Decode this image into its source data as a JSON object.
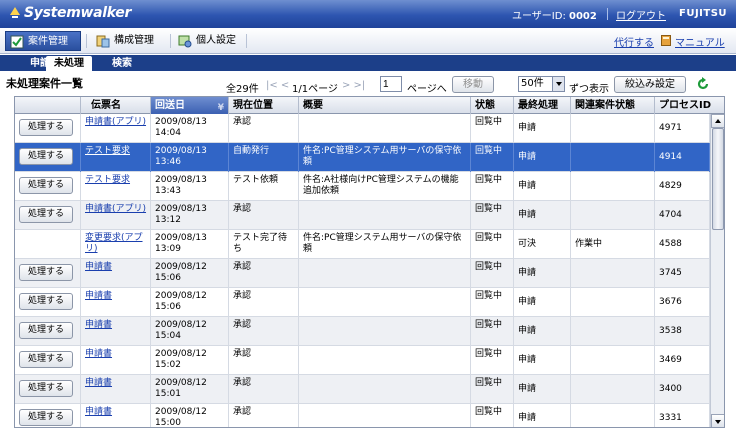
{
  "header": {
    "logo": "Systemwalker",
    "user_label": "ユーザーID:",
    "user_id": "0002",
    "logout": "ログアウト",
    "brand": "FUJITSU"
  },
  "menu": {
    "items": [
      {
        "label": "案件管理",
        "icon": "checkbox-icon",
        "active": true
      },
      {
        "label": "構成管理",
        "icon": "config-icon",
        "active": false
      },
      {
        "label": "個人設定",
        "icon": "person-settings-icon",
        "active": false
      }
    ],
    "delegate": "代行する",
    "manual": "マニュアル"
  },
  "tabs": [
    "申請",
    "未処理",
    "検索"
  ],
  "active_tab": "未処理",
  "page": {
    "title": "未処理案件一覧",
    "total": "全29件",
    "nav_arrows": "|< <",
    "page_info": "1/1ページ",
    "nav_arrows_next": "> >|",
    "page_input": "1",
    "page_to": "ページへ",
    "move_button": "移動",
    "per_page": "50件",
    "per_label": "ずつ表示",
    "filter_button": "絞込み設定"
  },
  "table": {
    "columns": [
      "",
      "伝票名",
      "回送日",
      "現在位置",
      "概要",
      "状態",
      "最終処理",
      "関連案件状態",
      "プロセスID"
    ],
    "sorted_column": "回送日",
    "rows": [
      {
        "btn": "処理する",
        "name": "申請書(アプリ)",
        "date": "2009/08/13 14:04",
        "pos": "承認",
        "summary": "",
        "status": "回覧中",
        "last": "申請",
        "related": "",
        "pid": "4971",
        "style": ""
      },
      {
        "btn": "処理する",
        "name": "テスト要求",
        "date": "2009/08/13 13:46",
        "pos": "自動発行",
        "summary": "件名:PC管理システム用サーバの保守依頼",
        "status": "回覧中",
        "last": "申請",
        "related": "",
        "pid": "4914",
        "style": "sel"
      },
      {
        "btn": "処理する",
        "name": "テスト要求",
        "date": "2009/08/13 13:43",
        "pos": "テスト依頼",
        "summary": "件名:A社様向けPC管理システムの機能追加依頼",
        "status": "回覧中",
        "last": "申請",
        "related": "",
        "pid": "4829",
        "style": ""
      },
      {
        "btn": "処理する",
        "name": "申請書(アプリ)",
        "date": "2009/08/13 13:12",
        "pos": "承認",
        "summary": "",
        "status": "回覧中",
        "last": "申請",
        "related": "",
        "pid": "4704",
        "style": "alt"
      },
      {
        "btn": "",
        "name": "変更要求(アプリ)",
        "date": "2009/08/13 13:09",
        "pos": "テスト完了待ち",
        "summary": "件名:PC管理システム用サーバの保守依頼",
        "status": "回覧中",
        "last": "可決",
        "related": "作業中",
        "pid": "4588",
        "style": ""
      },
      {
        "btn": "処理する",
        "name": "申請書",
        "date": "2009/08/12 15:06",
        "pos": "承認",
        "summary": "",
        "status": "回覧中",
        "last": "申請",
        "related": "",
        "pid": "3745",
        "style": "alt"
      },
      {
        "btn": "処理する",
        "name": "申請書",
        "date": "2009/08/12 15:06",
        "pos": "承認",
        "summary": "",
        "status": "回覧中",
        "last": "申請",
        "related": "",
        "pid": "3676",
        "style": ""
      },
      {
        "btn": "処理する",
        "name": "申請書",
        "date": "2009/08/12 15:04",
        "pos": "承認",
        "summary": "",
        "status": "回覧中",
        "last": "申請",
        "related": "",
        "pid": "3538",
        "style": "alt"
      },
      {
        "btn": "処理する",
        "name": "申請書",
        "date": "2009/08/12 15:02",
        "pos": "承認",
        "summary": "",
        "status": "回覧中",
        "last": "申請",
        "related": "",
        "pid": "3469",
        "style": ""
      },
      {
        "btn": "処理する",
        "name": "申請書",
        "date": "2009/08/12 15:01",
        "pos": "承認",
        "summary": "",
        "status": "回覧中",
        "last": "申請",
        "related": "",
        "pid": "3400",
        "style": "alt"
      },
      {
        "btn": "処理する",
        "name": "申請書",
        "date": "2009/08/12 15:00",
        "pos": "承認",
        "summary": "",
        "status": "回覧中",
        "last": "申請",
        "related": "",
        "pid": "3331",
        "style": ""
      }
    ]
  },
  "colors": {
    "accent": "#2d55b0",
    "tabbar": "#1c3f89",
    "selected_row": "#3165c6",
    "link": "#1a3fae",
    "refresh": "#1e9b3a"
  }
}
